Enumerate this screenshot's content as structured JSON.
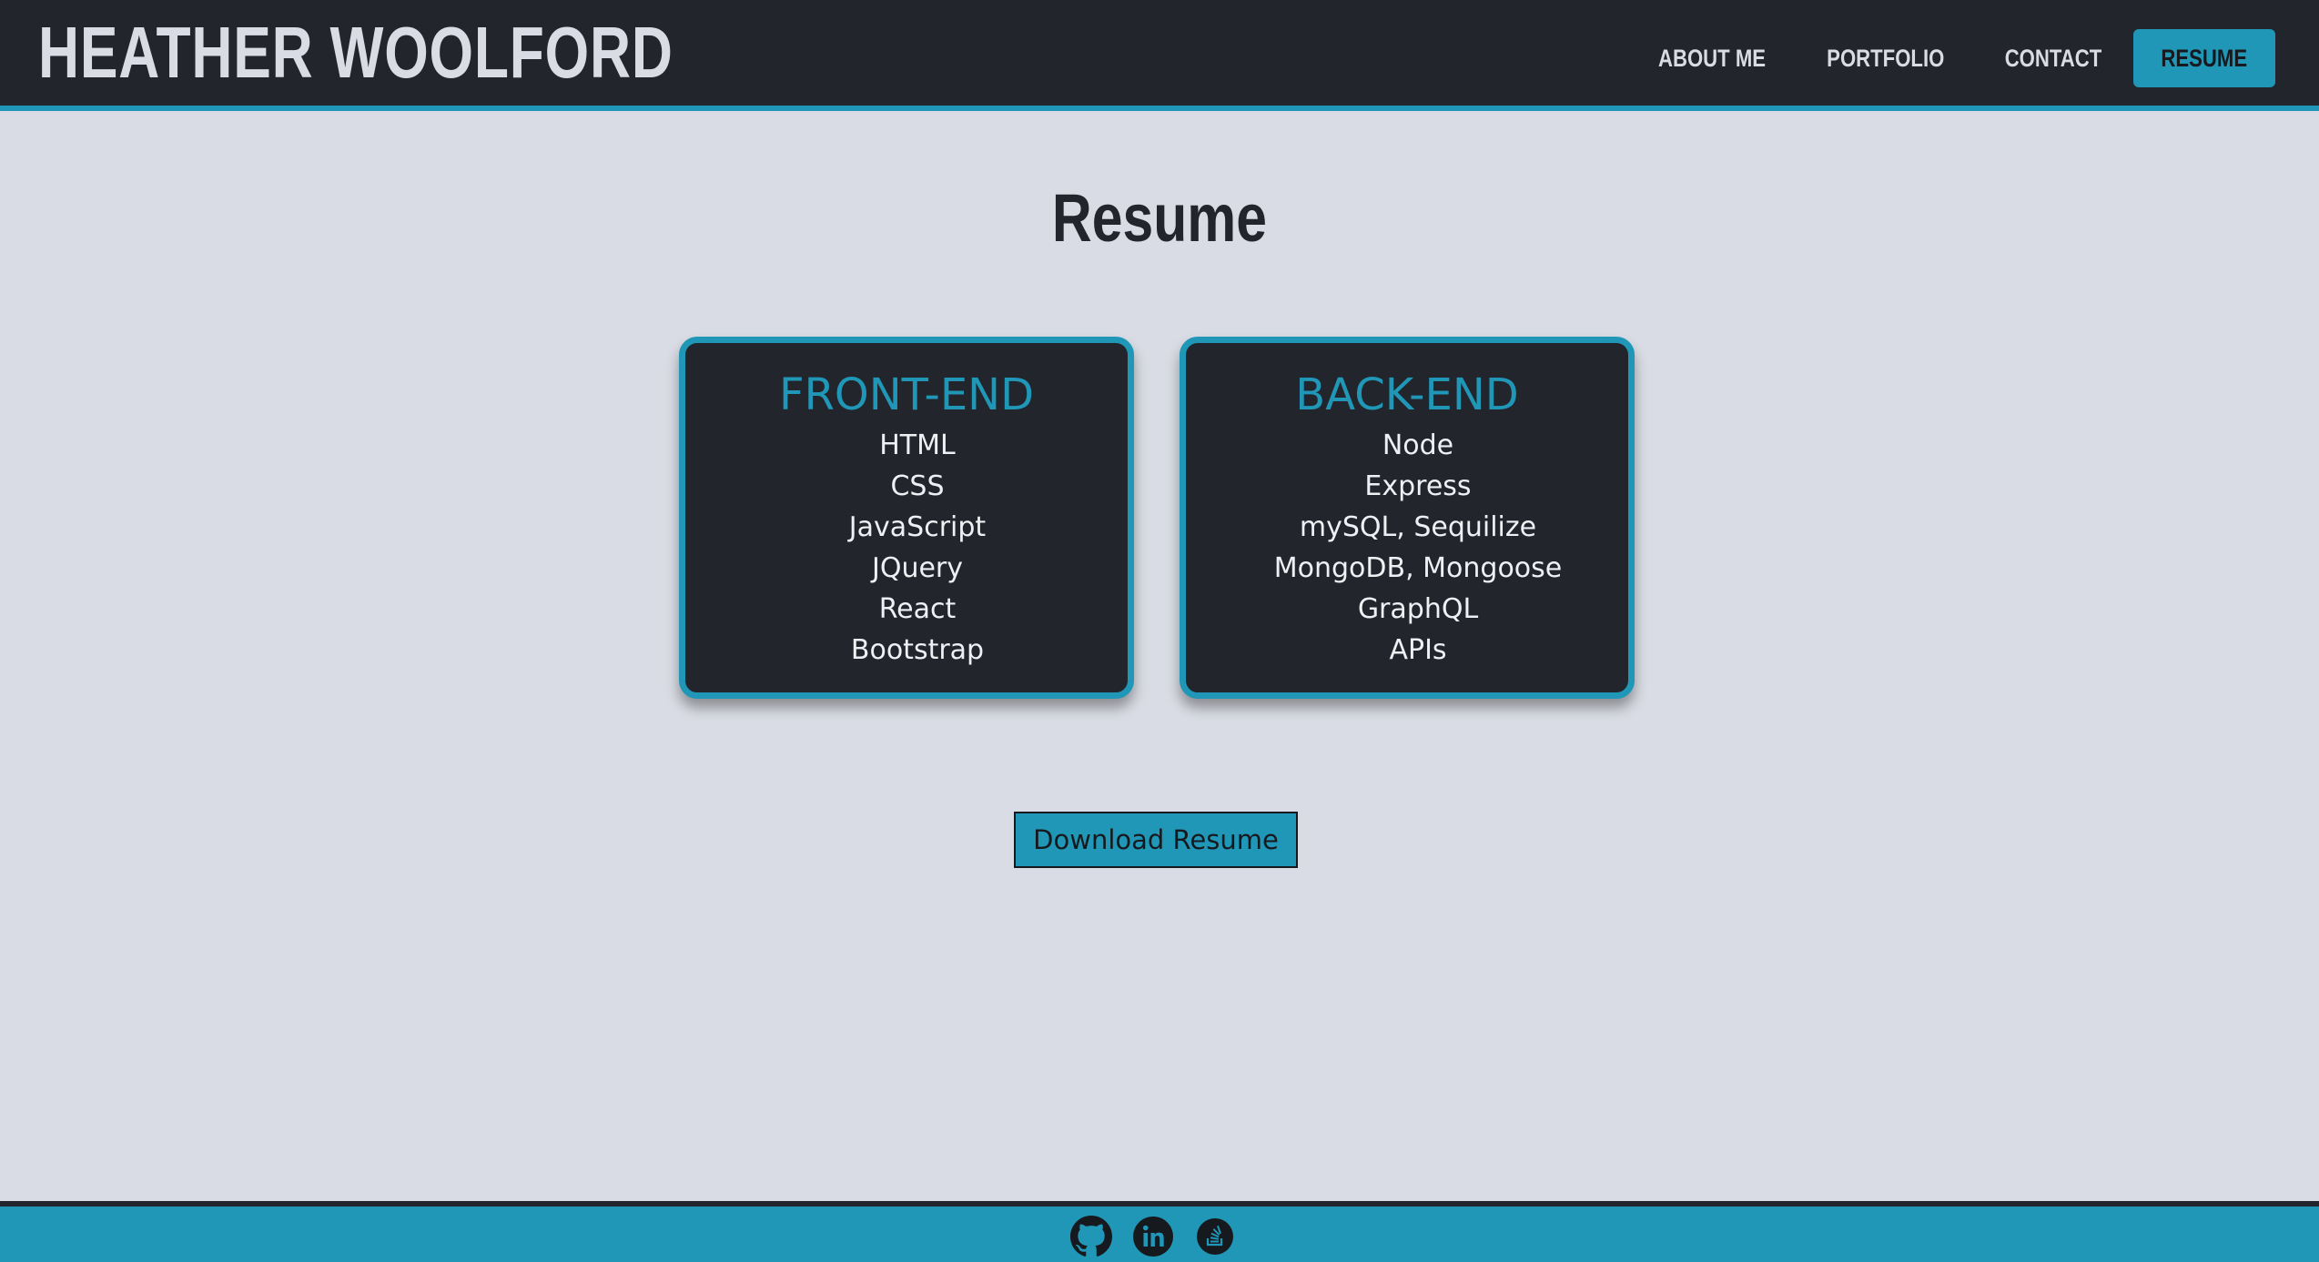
{
  "header": {
    "site_title": "HEATHER WOOLFORD",
    "nav": [
      {
        "label": "ABOUT ME"
      },
      {
        "label": "PORTFOLIO"
      },
      {
        "label": "CONTACT"
      },
      {
        "label": "RESUME",
        "active": true
      }
    ]
  },
  "main": {
    "page_title": "Resume",
    "front_end": {
      "title": "FRONT-END",
      "skills": [
        "HTML",
        "CSS",
        "JavaScript",
        "JQuery",
        "React",
        "Bootstrap"
      ]
    },
    "back_end": {
      "title": "BACK-END",
      "skills": [
        "Node",
        "Express",
        "mySQL, Sequilize",
        "MongoDB, Mongoose",
        "GraphQL",
        "APIs"
      ]
    },
    "download_label": "Download Resume"
  },
  "footer": {
    "icons": [
      "github-icon",
      "linkedin-icon",
      "stackoverflow-icon"
    ]
  },
  "colors": {
    "accent": "#2197b8",
    "dark": "#22252b",
    "background": "#d9dce4"
  }
}
